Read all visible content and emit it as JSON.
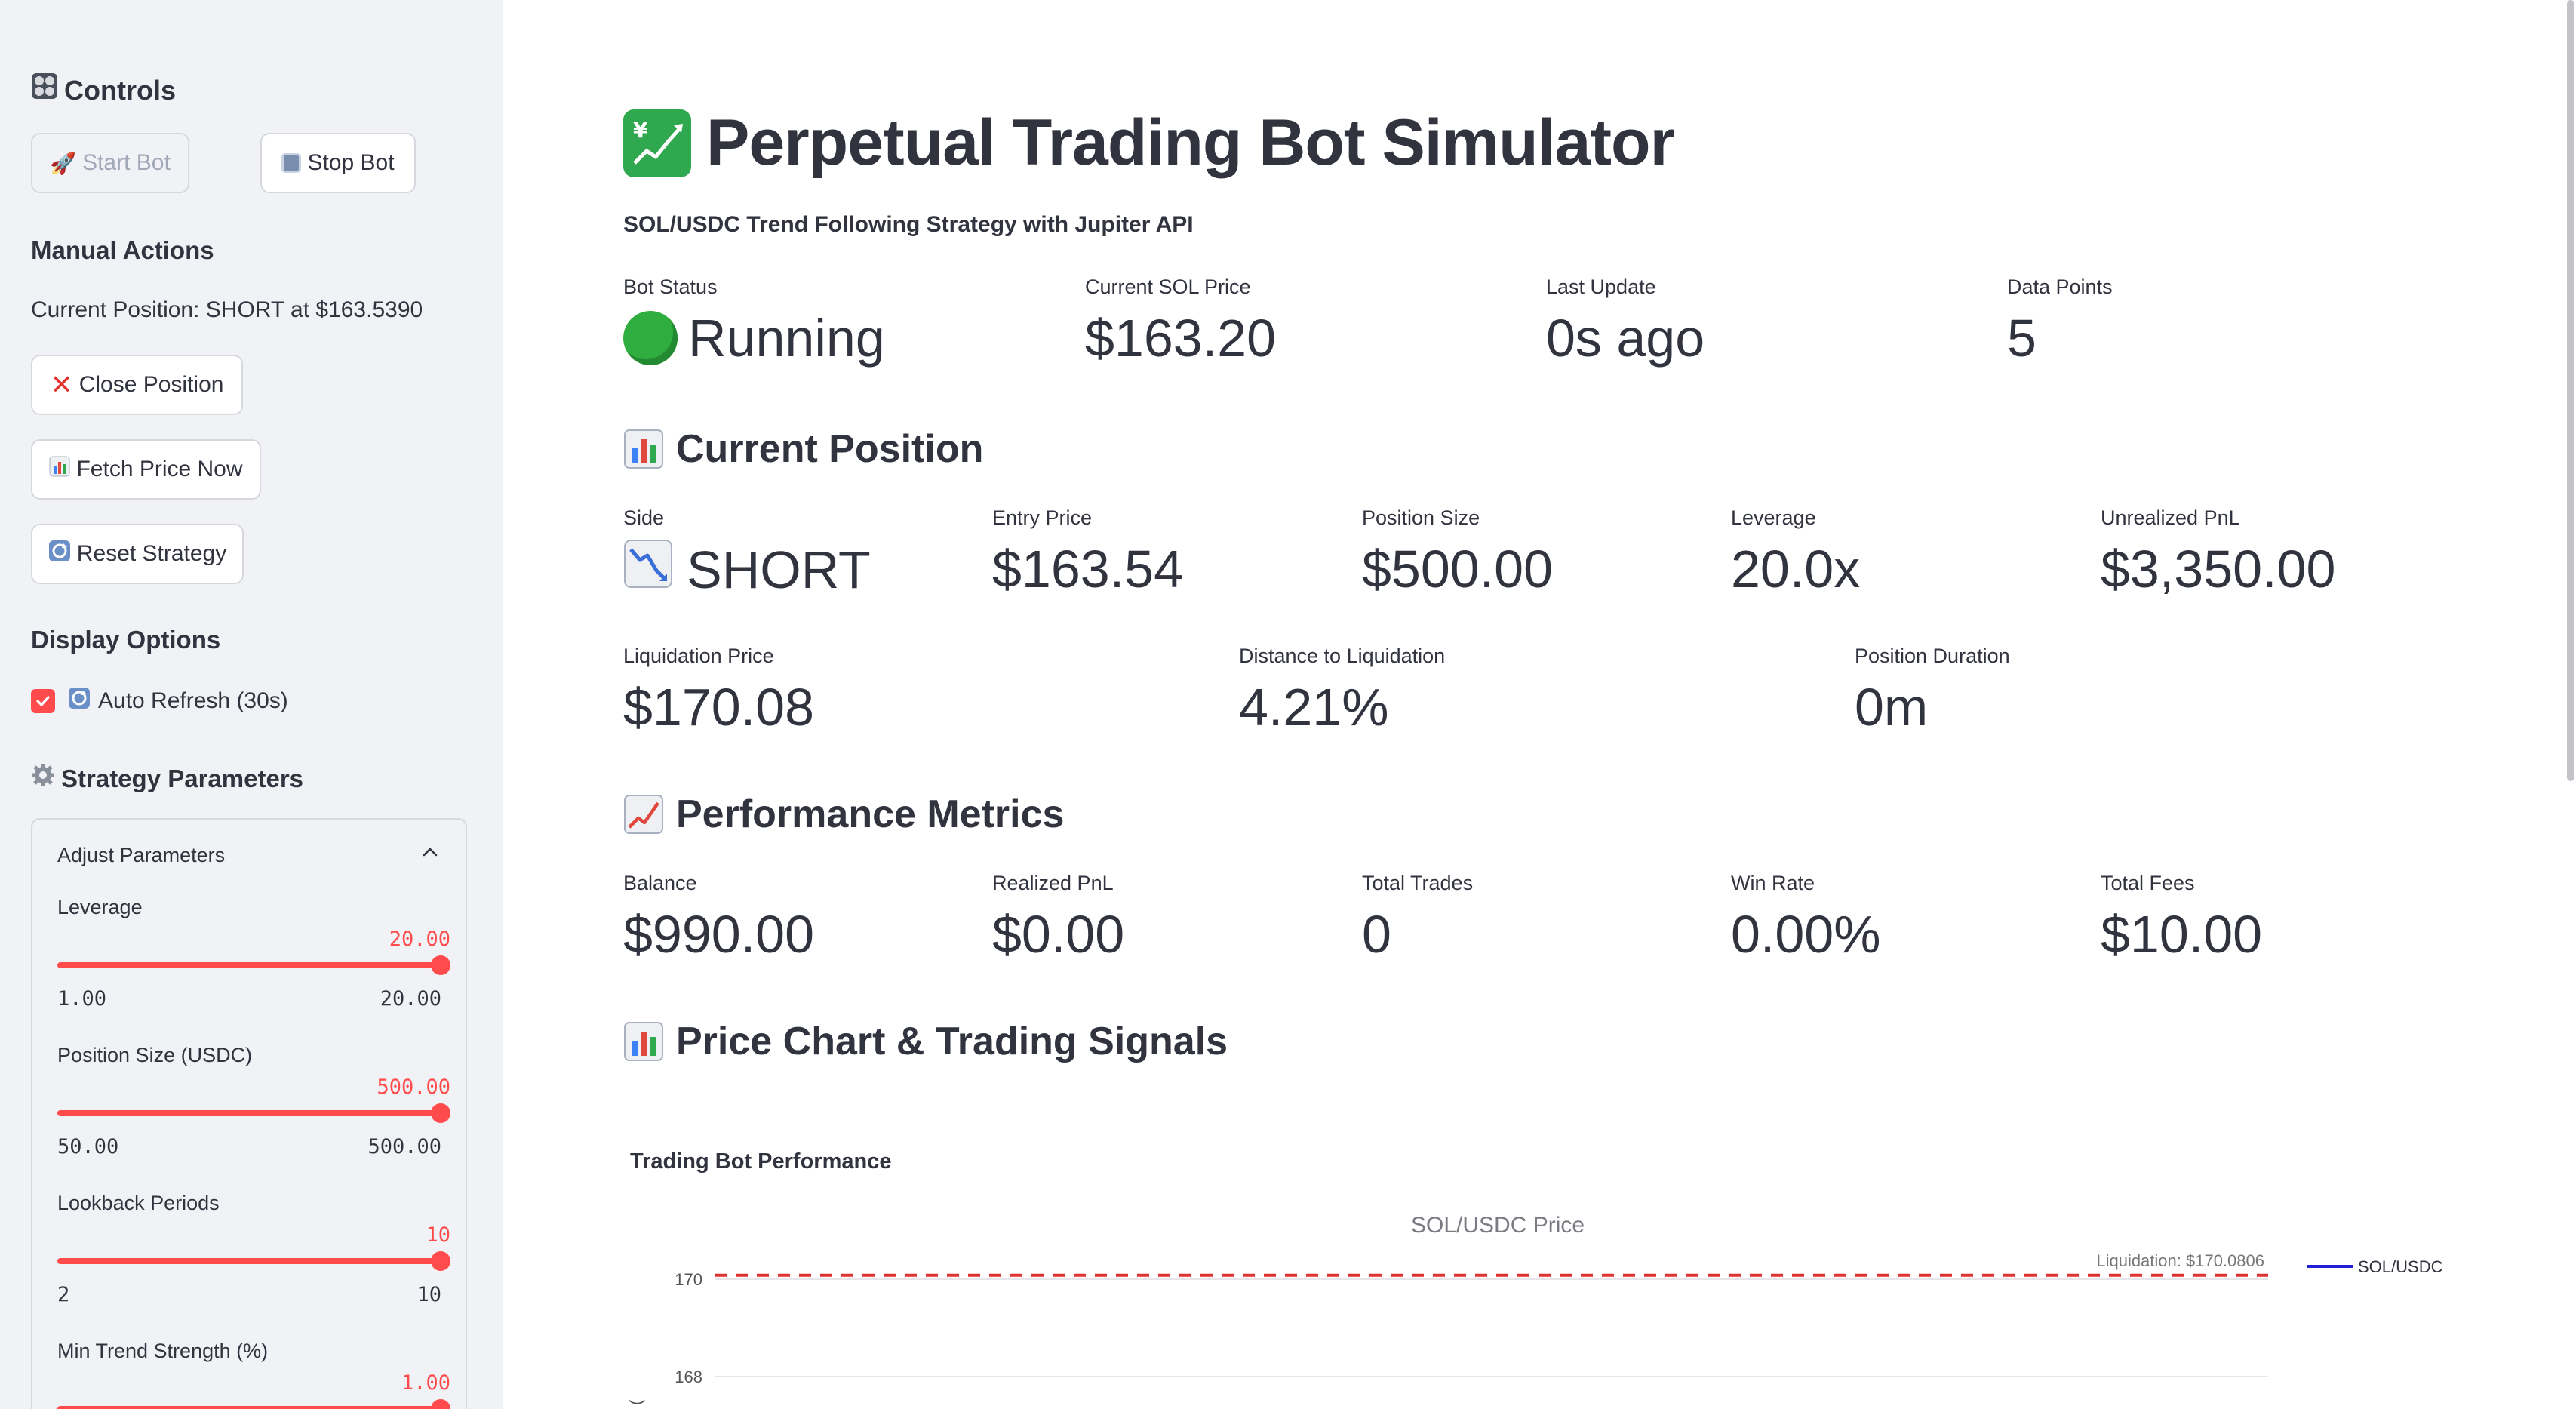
{
  "sidebar": {
    "controls_heading": "Controls",
    "start_bot_label": "Start Bot",
    "stop_bot_label": "Stop Bot",
    "manual_actions_heading": "Manual Actions",
    "current_position_text": "Current Position: SHORT at $163.5390",
    "close_position_label": "Close Position",
    "fetch_price_label": "Fetch Price Now",
    "reset_strategy_label": "Reset Strategy",
    "display_options_heading": "Display Options",
    "auto_refresh_label": "Auto Refresh (30s)",
    "auto_refresh_checked": true,
    "strategy_params_heading": "Strategy Parameters",
    "adjust_params_label": "Adjust Parameters",
    "sliders": [
      {
        "label": "Leverage",
        "value": "20.00",
        "min": "1.00",
        "max": "20.00",
        "fraction": 1.0
      },
      {
        "label": "Position Size (USDC)",
        "value": "500.00",
        "min": "50.00",
        "max": "500.00",
        "fraction": 1.0
      },
      {
        "label": "Lookback Periods",
        "value": "10",
        "min": "2",
        "max": "10",
        "fraction": 1.0
      },
      {
        "label": "Min Trend Strength (%)",
        "value": "1.00",
        "min": "",
        "max": "",
        "fraction": 1.0
      }
    ]
  },
  "header": {
    "title": "Perpetual Trading Bot Simulator",
    "subtitle": "SOL/USDC Trend Following Strategy with Jupiter API"
  },
  "status": {
    "bot_status_label": "Bot Status",
    "bot_status_value": "Running",
    "price_label": "Current SOL Price",
    "price_value": "$163.20",
    "last_update_label": "Last Update",
    "last_update_value": "0s ago",
    "data_points_label": "Data Points",
    "data_points_value": "5"
  },
  "position": {
    "heading": "Current Position",
    "side_label": "Side",
    "side_value": "SHORT",
    "entry_label": "Entry Price",
    "entry_value": "$163.54",
    "size_label": "Position Size",
    "size_value": "$500.00",
    "leverage_label": "Leverage",
    "leverage_value": "20.0x",
    "pnl_label": "Unrealized PnL",
    "pnl_value": "$3,350.00",
    "liq_label": "Liquidation Price",
    "liq_value": "$170.08",
    "dist_label": "Distance to Liquidation",
    "dist_value": "4.21%",
    "duration_label": "Position Duration",
    "duration_value": "0m"
  },
  "performance": {
    "heading": "Performance Metrics",
    "balance_label": "Balance",
    "balance_value": "$990.00",
    "realized_label": "Realized PnL",
    "realized_value": "$0.00",
    "trades_label": "Total Trades",
    "trades_value": "0",
    "winrate_label": "Win Rate",
    "winrate_value": "0.00%",
    "fees_label": "Total Fees",
    "fees_value": "$10.00"
  },
  "chart_section": {
    "heading": "Price Chart & Trading Signals",
    "chart_title": "Trading Bot Performance",
    "plot_title": "SOL/USDC Price"
  },
  "chart_data": {
    "type": "line",
    "title": "SOL/USDC Price",
    "y_ticks": [
      170,
      168
    ],
    "y_axis_label_partial": "(",
    "legend": [
      {
        "name": "SOL/USDC",
        "color": "#1f1fd6"
      }
    ],
    "legend_position": "top-right",
    "reference_lines": [
      {
        "label": "Liquidation: $170.0806",
        "y": 170.0806,
        "style": "dashed",
        "color": "#e03131"
      }
    ],
    "grid": true
  },
  "colors": {
    "accent": "#ff4b4b",
    "sidebar_bg": "#f0f2f6",
    "text": "#31333f",
    "status_green": "#1fa83a"
  }
}
